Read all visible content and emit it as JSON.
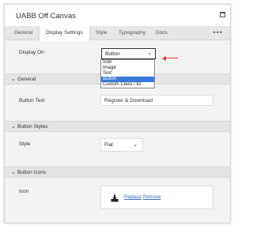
{
  "window": {
    "title": "UABB Off Canvas"
  },
  "tabs": [
    {
      "label": "General"
    },
    {
      "label": "Display Settings"
    },
    {
      "label": "Style"
    },
    {
      "label": "Typography"
    },
    {
      "label": "Docs"
    }
  ],
  "tabs_more": "•••",
  "display_on": {
    "label": "Display On",
    "selected": "Button",
    "options": [
      "Icon",
      "Image",
      "Text",
      "Button",
      "Custom Class / ID"
    ]
  },
  "general_section": {
    "title": "General",
    "button_text_label": "Button Text",
    "button_text_value": "Register & Download"
  },
  "button_styles_section": {
    "title": "Button Styles",
    "style_label": "Style",
    "style_value": "Flat"
  },
  "button_icons_section": {
    "title": "Button Icons",
    "icon_label": "Icon",
    "replace_link": "Replace",
    "remove_link": "Remove"
  },
  "colors": {
    "highlight": "#3a78d8",
    "annotation_arrow": "#e53935",
    "link": "#3568c8"
  }
}
